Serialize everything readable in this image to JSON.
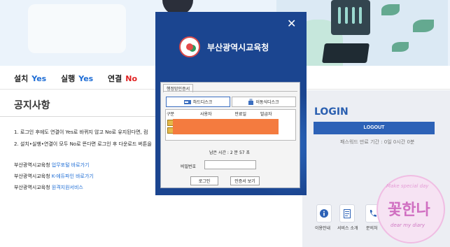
{
  "status": [
    {
      "key": "설치",
      "value": "Yes",
      "state": "yes"
    },
    {
      "key": "실행",
      "value": "Yes",
      "state": "yes"
    },
    {
      "key": "연결",
      "value": "No",
      "state": "no"
    }
  ],
  "notice": {
    "title": "공지사항",
    "items": [
      "1. 로그인 후에도 연결이 Yes로 바뀌지 않고 No로 유지된다면, 컴",
      "2. 설치•실행•연결이 모두 No로 뜬다면 로그인 후 다운로드 버튼을"
    ],
    "links": [
      {
        "prefix": "부산광역시교육청 ",
        "text": "업무포털 바로가기"
      },
      {
        "prefix": "부산광역시교육청 ",
        "text": "K-에듀파인 바로가기"
      },
      {
        "prefix": "부산광역시교육청 ",
        "text": "원격지원서비스"
      }
    ]
  },
  "login": {
    "title": "LOGIN",
    "logout_label": "LOGOUT",
    "pw_expiry": "패스워드 만료 기간 : 0일 0시간 0분"
  },
  "quick_menu": [
    {
      "label": "이용안내",
      "icon": "info-icon"
    },
    {
      "label": "서비스 소개",
      "icon": "document-icon"
    },
    {
      "label": "문의처",
      "icon": "phone-icon"
    }
  ],
  "watermark": {
    "top": "Make special day",
    "main": "꽃한나",
    "bottom": "dear my diary"
  },
  "modal": {
    "org_name": "부산광역시교육청",
    "close_label": "✕",
    "cert_tab": "행정망인증서",
    "disk_buttons": [
      "하드디스크",
      "이동식디스크"
    ],
    "columns": [
      "구분",
      "사용자",
      "만료일",
      "발급자"
    ],
    "remaining_time": "남은 시간 : 2 분 57 초",
    "password_label": "비밀번호",
    "login_button": "로그인",
    "view_cert_button": "인증서 보기"
  },
  "colors": {
    "yes": "#1e6dd5",
    "no": "#e02020",
    "modal_bg": "#1b4590",
    "logout_bg": "#2d62b7",
    "redaction": "#f47b3f"
  }
}
